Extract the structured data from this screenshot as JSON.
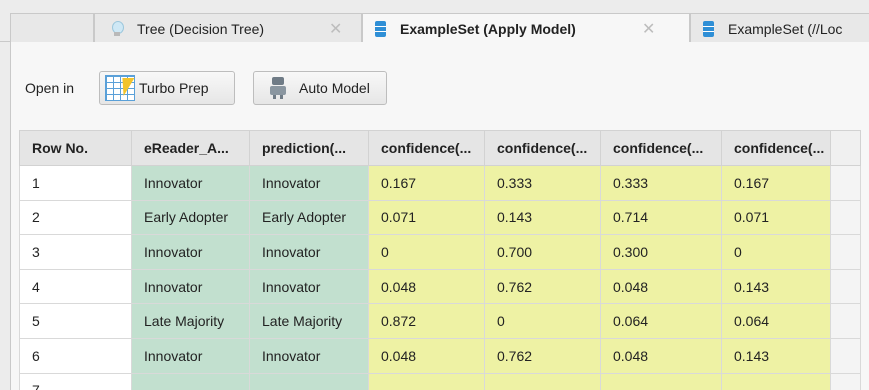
{
  "tabs": [
    {
      "label": "Tree (Decision Tree)",
      "icon": "lightbulb-icon",
      "active": false
    },
    {
      "label": "ExampleSet (Apply Model)",
      "icon": "database-icon",
      "active": true
    },
    {
      "label": "ExampleSet (//Loc",
      "icon": "database-icon",
      "active": false
    }
  ],
  "toolbar": {
    "open_in_label": "Open in",
    "turbo_prep_label": "Turbo Prep",
    "auto_model_label": "Auto Model"
  },
  "table": {
    "headers": [
      "Row No.",
      "eReader_A...",
      "prediction(...",
      "confidence(...",
      "confidence(...",
      "confidence(...",
      "confidence(..."
    ],
    "rows": [
      [
        "1",
        "Innovator",
        "Innovator",
        "0.167",
        "0.333",
        "0.333",
        "0.167"
      ],
      [
        "2",
        "Early Adopter",
        "Early Adopter",
        "0.071",
        "0.143",
        "0.714",
        "0.071"
      ],
      [
        "3",
        "Innovator",
        "Innovator",
        "0",
        "0.700",
        "0.300",
        "0"
      ],
      [
        "4",
        "Innovator",
        "Innovator",
        "0.048",
        "0.762",
        "0.048",
        "0.143"
      ],
      [
        "5",
        "Late Majority",
        "Late Majority",
        "0.872",
        "0",
        "0.064",
        "0.064"
      ],
      [
        "6",
        "Innovator",
        "Innovator",
        "0.048",
        "0.762",
        "0.048",
        "0.143"
      ],
      [
        "7",
        "",
        "",
        "",
        "",
        "",
        ""
      ]
    ]
  },
  "colors": {
    "nominal_cell": "#c2e0cf",
    "confidence_cell": "#eef2a4",
    "accent_blue": "#2f8fd6"
  }
}
